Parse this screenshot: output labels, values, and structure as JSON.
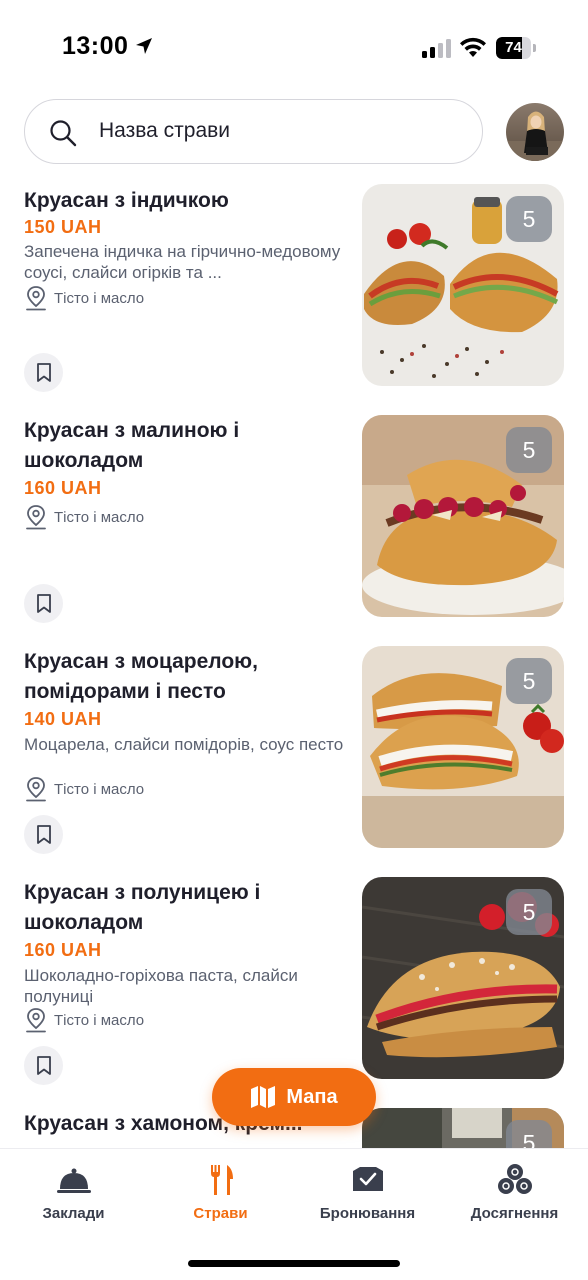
{
  "status_bar": {
    "time": "13:00",
    "battery": "74",
    "battery_level": 0.74
  },
  "search": {
    "placeholder": "Назва страви"
  },
  "dishes": [
    {
      "title": "Круасан з індичкою",
      "price": "150 UAH",
      "description": "Запечена індичка на гірчично-медовому соусі, слайси огірків та ...",
      "location": "Тісто і масло",
      "badge": "5"
    },
    {
      "title": "Круасан з малиною і шоколадом",
      "price": "160 UAH",
      "description": "",
      "location": "Тісто і масло",
      "badge": "5"
    },
    {
      "title": "Круасан з моцарелою, помідорами і песто",
      "price": "140 UAH",
      "description": "Моцарела, слайси помідорів, соус песто",
      "location": "Тісто і масло",
      "badge": "5"
    },
    {
      "title": "Круасан з полуницею і шоколадом",
      "price": "160 UAH",
      "description": "Шоколадно-горіхова паста, слайси полуниці",
      "location": "Тісто і масло",
      "badge": "5"
    },
    {
      "title": "Круасан з хамоном, крем...",
      "badge": "5"
    }
  ],
  "map_button": {
    "label": "Мапа",
    "icon": "map-icon"
  },
  "bottom_nav": [
    {
      "label": "Заклади",
      "icon": "cloche-icon",
      "active": false
    },
    {
      "label": "Страви",
      "icon": "fork-knife-icon",
      "active": true
    },
    {
      "label": "Бронювання",
      "icon": "booking-icon",
      "active": false
    },
    {
      "label": "Досягнення",
      "icon": "achievements-icon",
      "active": false
    }
  ],
  "colors": {
    "accent": "#f26d12",
    "text": "#1f1f2b",
    "muted": "#5b6170"
  }
}
